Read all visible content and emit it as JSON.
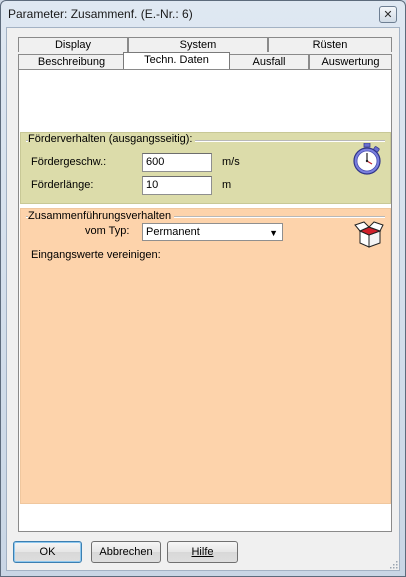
{
  "window": {
    "title": "Parameter: Zusammenf. (E.-Nr.:  6)",
    "close_glyph": "✕"
  },
  "tabs": {
    "row1": [
      {
        "label": "Display"
      },
      {
        "label": "System"
      },
      {
        "label": "Rüsten"
      }
    ],
    "row2": [
      {
        "label": "Beschreibung"
      },
      {
        "label": "Techn. Daten",
        "active": true
      },
      {
        "label": "Ausfall"
      },
      {
        "label": "Auswertung"
      }
    ]
  },
  "conveyor": {
    "title": "Förderverhalten (ausgangsseitig):",
    "speed_label": "Fördergeschw.:",
    "speed_value": "600",
    "speed_unit": "m/s",
    "length_label": "Förderlänge:",
    "length_value": "10",
    "length_unit": "m",
    "icon": "stopwatch-icon"
  },
  "merge": {
    "title": "Zusammenführungsverhalten",
    "type_label": "vom Typ:",
    "type_value": "Permanent",
    "inputs_label": "Eingangswerte vereinigen:",
    "icon": "open-box-icon"
  },
  "buttons": {
    "ok": "OK",
    "cancel": "Abbrechen",
    "help": "Hilfe"
  },
  "colors": {
    "conveyor_group_bg": "#dcdcaa",
    "merge_group_bg": "#fdd3ab",
    "default_button_border": "#3c7fb1"
  }
}
